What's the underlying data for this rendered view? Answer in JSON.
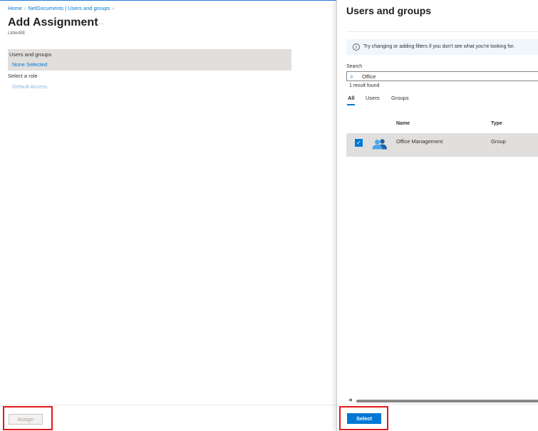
{
  "left": {
    "breadcrumb": [
      "Home",
      "NetDocuments | Users and groups"
    ],
    "title": "Add Assignment",
    "more_label": "···",
    "subtitle": "LittlerBE",
    "users_groups_label": "Users and groups",
    "users_groups_value": "None Selected",
    "role_label": "Select a role",
    "role_value": "Default Access",
    "assign_label": "Assign"
  },
  "right": {
    "title": "Users and groups",
    "info_text": "Try changing or adding filters if you don't see what you're looking for.",
    "search_label": "Search",
    "search_value": "Office",
    "result_count": "1 result found",
    "tabs": [
      "All",
      "Users",
      "Groups"
    ],
    "columns": [
      "Name",
      "Type"
    ],
    "rows": [
      {
        "name": "Office Management",
        "type": "Group",
        "selected": true
      }
    ],
    "select_label": "Select"
  },
  "colors": {
    "accent": "#0078d4",
    "highlight": "#e0191a"
  }
}
